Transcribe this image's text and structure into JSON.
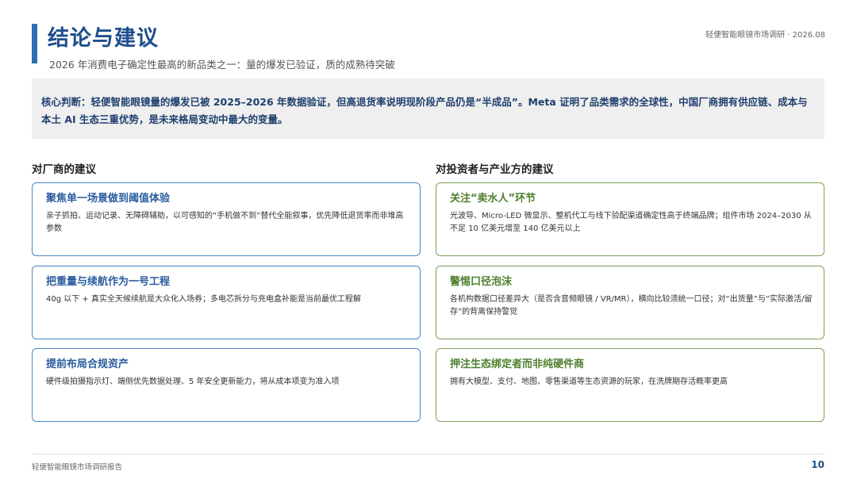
{
  "header": {
    "title": "结论与建议",
    "subtitle": "2026 年消费电子确定性最高的新品类之一：量的爆发已验证，质的成熟待突破",
    "top_right": "轻便智能眼镜市场调研 · 2026.08"
  },
  "summary": {
    "text": "核心判断：轻便智能眼镜量的爆发已被 2025–2026 年数据验证，但高退货率说明现阶段产品仍是“半成品”。Meta 证明了品类需求的全球性，中国厂商拥有供应链、成本与本土 AI 生态三重优势，是未来格局变动中最大的变量。"
  },
  "left_column": {
    "heading": "对厂商的建议",
    "cards": [
      {
        "title": "聚焦单一场景做到阈值体验",
        "body": "亲子抓拍、运动记录、无障碍辅助，以可感知的“手机做不到”替代全能叙事，优先降低退货率而非堆高参数"
      },
      {
        "title": "把重量与续航作为一号工程",
        "body": "40g 以下 + 真实全天候续航是大众化入场券；多电芯拆分与充电盒补能是当前最优工程解"
      },
      {
        "title": "提前布局合规资产",
        "body": "硬件级拍摄指示灯、端侧优先数据处理、5 年安全更新能力，将从成本项变为准入项"
      }
    ]
  },
  "right_column": {
    "heading": "对投资者与产业方的建议",
    "cards": [
      {
        "title": "关注“卖水人”环节",
        "body": "光波导、Micro-LED 微显示、整机代工与线下验配渠道确定性高于终端品牌；组件市场 2024–2030 从不足 10 亿美元增至 140 亿美元以上"
      },
      {
        "title": "警惕口径泡沫",
        "body": "各机构数据口径差异大（是否含音频眼镜 / VR/MR），横向比较须统一口径；对“出货量”与“实际激活/留存”的背离保持警觉"
      },
      {
        "title": "押注生态绑定者而非纯硬件商",
        "body": "拥有大模型、支付、地图、零售渠道等生态资源的玩家，在洗牌期存活概率更高"
      }
    ]
  },
  "footer": {
    "left": "轻便智能眼镜市场调研报告",
    "page": "10"
  },
  "colors": {
    "accent_blue": "#2f6db5",
    "title_blue": "#1f4e8c",
    "card_blue_border": "#4a86c8",
    "card_green_border": "#7ea25a",
    "card_green_title": "#4e7f2e",
    "summary_bg": "#efefef"
  }
}
